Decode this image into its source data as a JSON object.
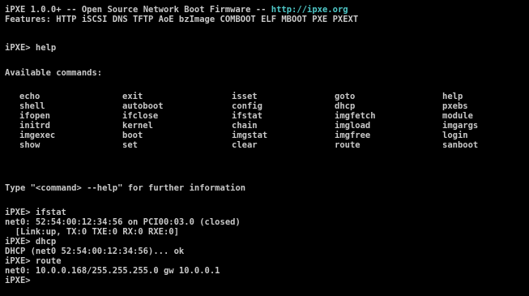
{
  "header": {
    "version": "iPXE 1.0.0+",
    "separator1": " -- ",
    "tagline": "Open Source Network Boot Firmware",
    "separator2": " -- ",
    "url": "http://ipxe.org",
    "features": "Features: HTTP iSCSI DNS TFTP AoE bzImage COMBOOT ELF MBOOT PXE PXEXT"
  },
  "session": {
    "prompt_help": "iPXE> help",
    "available_heading": "Available commands:",
    "commands": [
      [
        "echo",
        "exit",
        "isset",
        "goto",
        "help"
      ],
      [
        "shell",
        "autoboot",
        "config",
        "dhcp",
        "pxebs"
      ],
      [
        "ifopen",
        "ifclose",
        "ifstat",
        "imgfetch",
        "module"
      ],
      [
        "initrd",
        "kernel",
        "chain",
        "imgload",
        "imgargs"
      ],
      [
        "imgexec",
        "boot",
        "imgstat",
        "imgfree",
        "login"
      ],
      [
        "show",
        "set",
        "clear",
        "route",
        "sanboot"
      ]
    ],
    "help_hint": "Type \"<command> --help\" for further information",
    "prompt_ifstat": "iPXE> ifstat",
    "ifstat_line1": "net0: 52:54:00:12:34:56 on PCI00:03.0 (closed)",
    "ifstat_line2": "  [Link:up, TX:0 TXE:0 RX:0 RXE:0]",
    "prompt_dhcp": "iPXE> dhcp",
    "dhcp_result": "DHCP (net0 52:54:00:12:34:56)... ok",
    "prompt_route": "iPXE> route",
    "route_result": "net0: 10.0.0.168/255.255.255.0 gw 10.0.0.1",
    "prompt_final": "iPXE> "
  },
  "colors": {
    "background": "#000000",
    "text": "#c8c8c8",
    "url": "#4fc8c8"
  }
}
